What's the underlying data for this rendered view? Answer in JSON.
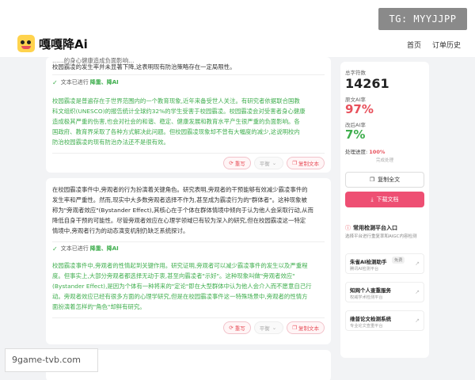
{
  "header": {
    "brand": "嘎嘎降Ai",
    "nav_home": "首页",
    "nav_orders": "订单历史"
  },
  "tg_badge": "TG: MYYJJPP",
  "card1": {
    "top_line1": "……的身心健康造成负面影响…",
    "top_line2": "校园霸凌的发生率并未显著下降,这表明现有防治策略存在一定局限性。",
    "done_prefix": "文本已进行",
    "done_keyword": "降重、降AI",
    "result_lines": [
      "校园霸凌是普遍存在于世界范围内的一个教育现象,近年来备受世人关注。有研究者依据联合国教",
      "科文组织(UNESCO)的报告统计全球约32%的学生受害于校园霸凌。校园霸凌会对受害者身心健康",
      "造成极其严重的伤害,也会对社会的和谐、稳定、健康发展和教育水平产生很严重的负面影响。各",
      "国政府、教育界采取了各种方式解决此问题。但校园霸凌现象却不曾有大幅度的减少,这说明校内",
      "防治校园霸凌的现有防治办法还不是很有效。"
    ],
    "btn_rewrite": "重写",
    "btn_mode": "平衡",
    "btn_copy": "复制文本"
  },
  "card2": {
    "orig_lines": [
      "在校园霸凌事件中,旁观者的行为扮演着关键角色。研究表明,旁观者的干预能够有效减少霸凌事件的",
      "发生率和严重性。然而,现实中大多数旁观者选择不作为,甚至成为霸凌行为的\"群体者\"。这种现象被",
      "称为\"旁观者效应\"(Bystander Effect),其核心在于个体在群体情境中倾向于认为他人会采取行动,从而",
      "降低自身干预的可能性。尽管旁观者效应在心理学领域已有较为深入的研究,但在校园霸凌这一特定",
      "情境中,旁观者行为的动态演变机制仍缺乏系统探讨。"
    ],
    "done_prefix": "文本已进行",
    "done_keyword": "降重、降AI",
    "result_lines": [
      "校园霸凌事件中,旁观者的性情起到关键作用。研究证明,旁观者可以减少霸凌事件的发生以及严重程",
      "度。但事实上,大部分旁观者都选择无动于衷,甚至向霸凌者\"示好\"。这种现象叫做\"旁观者效应\"",
      "(Bystander Effect),是因为个体有一种将来的\"定论\"即在大型群体中认为他人会介入而不愿意自己行",
      "动。旁观者效应已经有很多方面的心理学研究,但是在校园霸凌事件这一特殊场景中,旁观者的性情方",
      "面扮演着怎样的\"角色\"却鲜有研究。"
    ],
    "btn_rewrite": "重写",
    "btn_mode": "平衡",
    "btn_copy": "复制文本"
  },
  "sidebar": {
    "total_label": "总字符数",
    "total_value": "14261",
    "orig_ai_label": "原文AI率",
    "orig_ai_value": "97%",
    "after_ai_label": "改后AI率",
    "after_ai_value": "7%",
    "progress_label": "处理进度:",
    "progress_value": "100%",
    "progress_sub": "完成处理",
    "copy_all": "复制全文",
    "download": "下载文档"
  },
  "platforms": {
    "title": "常用检测平台入口",
    "subtitle": "选择平台进行重复率和AIGC内容检测",
    "items": [
      {
        "name": "朱雀AI检测助手",
        "tag": "免费",
        "desc": "腾讯AI检测平台"
      },
      {
        "name": "知网个人查重服务",
        "tag": "",
        "desc": "权威学术检测平台"
      },
      {
        "name": "维普论文检测系统",
        "tag": "",
        "desc": "专业论文查重平台"
      }
    ]
  },
  "watermark": "9game-tvb.com",
  "colors": {
    "accent": "#e8505b",
    "green": "#3fae4e",
    "download": "#ee4f73"
  }
}
